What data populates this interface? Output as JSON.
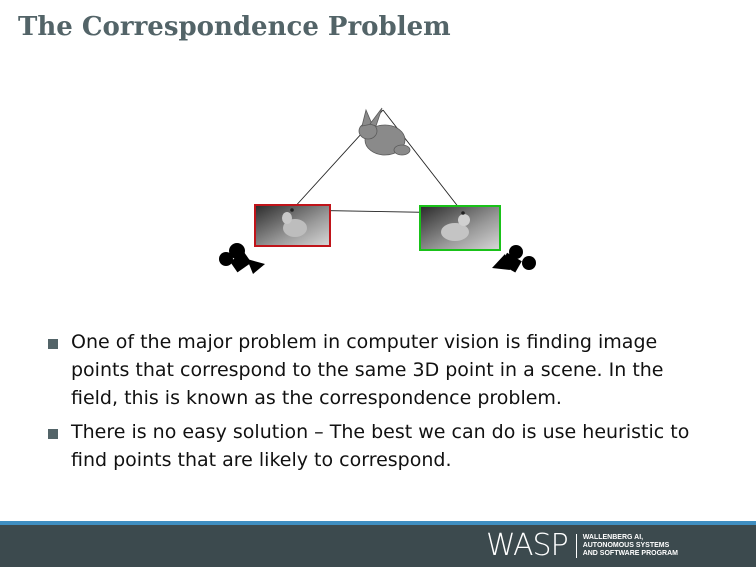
{
  "slide": {
    "title": "The Correspondence Problem"
  },
  "figure": {
    "colors": {
      "left_frame": "#c0141a",
      "right_frame": "#19c219",
      "camera": "#000000",
      "lines": "#222222"
    },
    "icons": [
      "bunny-model-icon",
      "left-camera-icon",
      "right-camera-icon"
    ]
  },
  "bullets": [
    {
      "text": "One of the major problem in computer vision is finding image points that correspond to the same 3D point in a scene. In the field, this is known as the correspondence problem."
    },
    {
      "text": "There is no easy solution – The best we can do is use heuristic to find points that are likely to correspond."
    }
  ],
  "footer": {
    "logo_word": "WASP",
    "logo_sub": [
      "WALLENBERG AI,",
      "AUTONOMOUS SYSTEMS",
      "AND SOFTWARE PROGRAM"
    ],
    "bar_color": "#3c4a4e",
    "accent_color": "#3f8ec1"
  }
}
